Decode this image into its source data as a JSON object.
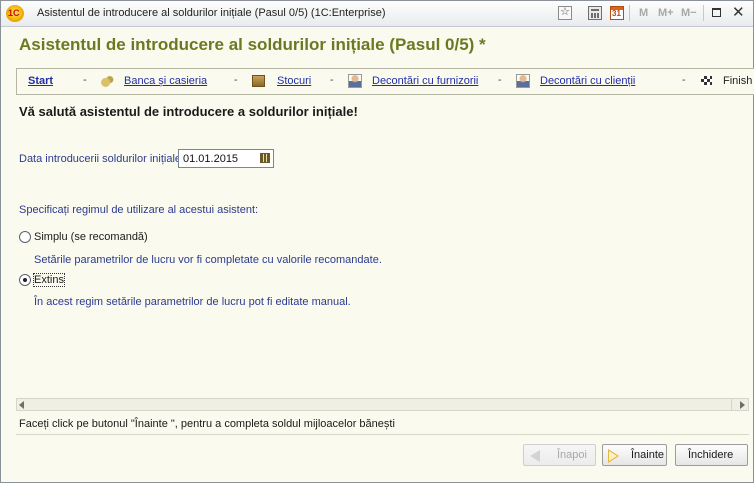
{
  "window": {
    "title": "Asistentul de introducere al soldurilor inițiale (Pasul 0/5)  (1C:Enterprise)",
    "logo_text": "1C",
    "memory_buttons": [
      "M",
      "M+",
      "M−"
    ]
  },
  "form": {
    "title": "Asistentul de introducere al soldurilor inițiale (Pasul 0/5) *"
  },
  "steps": [
    {
      "label": "Start",
      "icon": "none",
      "current": true
    },
    {
      "label": "Banca și casieria",
      "icon": "coins-icon"
    },
    {
      "label": "Stocuri",
      "icon": "box-icon"
    },
    {
      "label": "Decontări cu furnizorii",
      "icon": "person-icon"
    },
    {
      "label": "Decontări cu clienții",
      "icon": "person-icon"
    },
    {
      "label": "Finish",
      "icon": "checkered-flag-icon"
    }
  ],
  "step_separator": "-",
  "main": {
    "welcome": "Vă salută asistentul de introducere a soldurilor inițiale!",
    "date_label": "Data introducerii soldurilor inițiale:",
    "date_value": "01.01.2015",
    "mode_label": "Specificați regimul de utilizare al acestui asistent:",
    "options": [
      {
        "label": "Simplu (se recomandă)",
        "description": "Setările parametrilor de lucru vor fi completate cu valorile recomandate.",
        "selected": false
      },
      {
        "label": "Extins",
        "description": "În acest regim setările parametrilor de lucru pot fi editate manual.",
        "selected": true
      }
    ]
  },
  "hint": "Faceți click pe butonul \"Înainte \", pentru a completa soldul mijloacelor bănești",
  "buttons": {
    "back": "Înapoi",
    "next": "Înainte",
    "close": "Închidere"
  },
  "colors": {
    "title_green": "#6b7a22",
    "link_blue": "#1f2ea5",
    "label_blue": "#2b3b8f",
    "background": "#fbfaee"
  }
}
